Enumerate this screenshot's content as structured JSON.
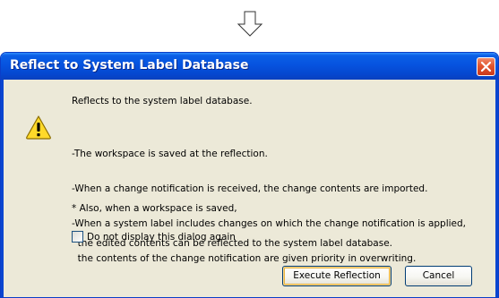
{
  "dialog": {
    "title": "Reflect to System Label Database",
    "message_header": "Reflects to the system label database.",
    "notes": [
      "-The workspace is saved at the reflection.",
      "-When a change notification is received, the change contents are imported.",
      "-When a system label includes changes on which the change notification is applied,",
      "  the contents of the change notification are given priority in overwriting."
    ],
    "also_lines": [
      "* Also, when a workspace is saved,",
      "  the edited contents can be reflected to the system label database."
    ],
    "checkbox": {
      "label": "Do not display this dialog again",
      "checked": false
    },
    "buttons": {
      "execute_label": "Execute Reflection",
      "cancel_label": "Cancel"
    }
  },
  "icons": {
    "top_arrow": "down-arrow-icon",
    "close": "close-icon",
    "warning": "warning-icon"
  },
  "colors": {
    "titlebar": "#0653df",
    "dialog_background": "#ece9d8",
    "close_button": "#e2562f",
    "warning_yellow": "#ffd92a"
  }
}
